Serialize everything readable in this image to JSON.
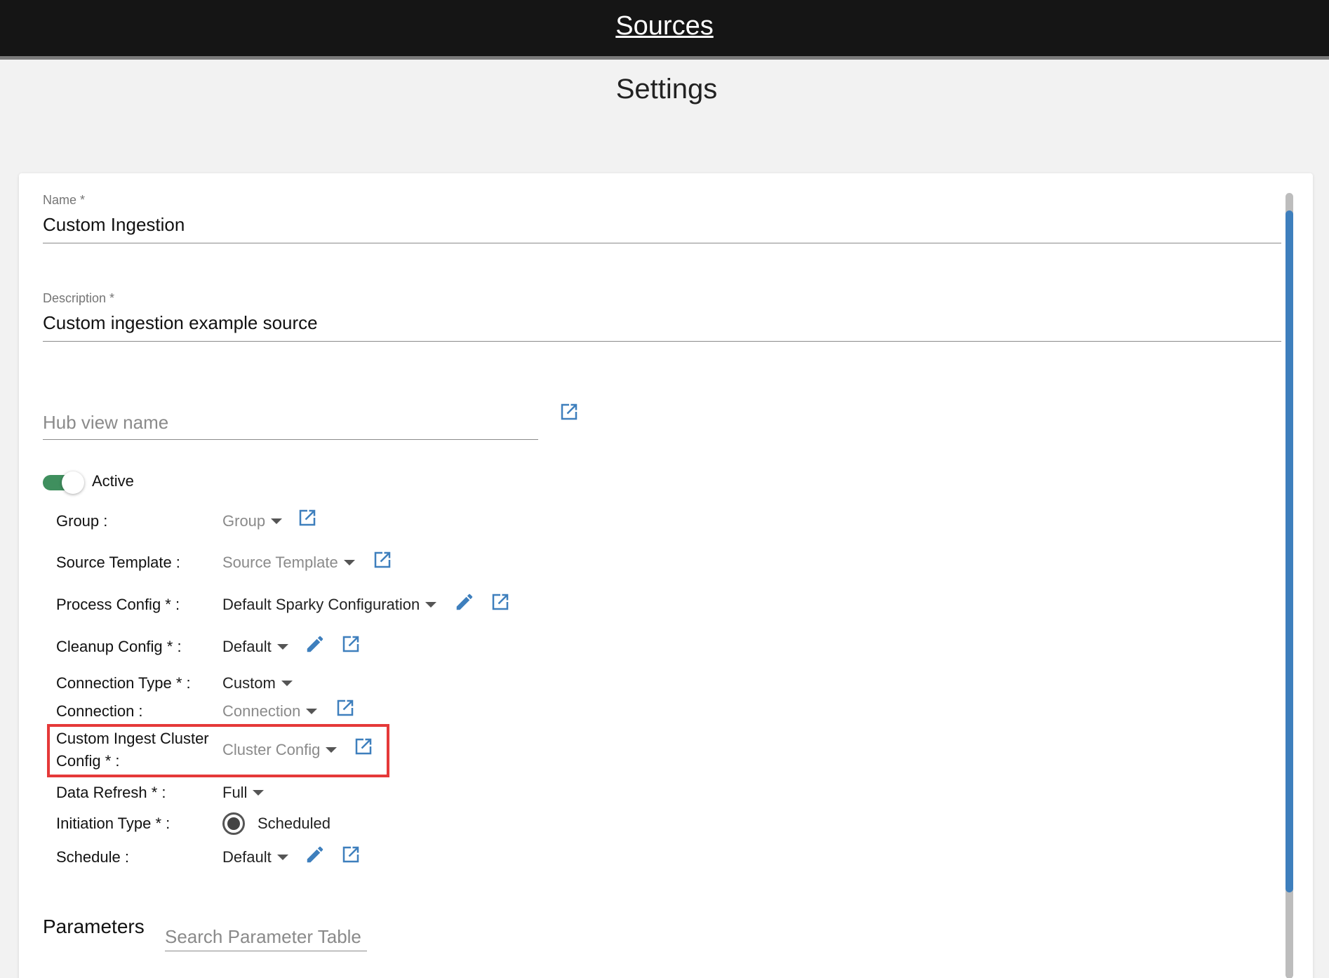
{
  "header": {
    "link_label": "Sources"
  },
  "page": {
    "title": "Settings"
  },
  "form": {
    "name": {
      "label": "Name *",
      "value": "Custom Ingestion"
    },
    "description": {
      "label": "Description *",
      "value": "Custom ingestion example source"
    },
    "hub_view": {
      "placeholder": "Hub view name"
    },
    "active": {
      "label": "Active",
      "checked": true
    },
    "rows": {
      "group": {
        "label": "Group :",
        "value": "Group"
      },
      "source_template": {
        "label": "Source Template :",
        "value": "Source Template"
      },
      "process_config": {
        "label": "Process Config * :",
        "value": "Default Sparky Configuration"
      },
      "cleanup_config": {
        "label": "Cleanup Config * :",
        "value": "Default"
      },
      "connection_type": {
        "label": "Connection Type * :",
        "value": "Custom"
      },
      "connection": {
        "label": "Connection :",
        "value": "Connection"
      },
      "cluster_config": {
        "label_line1": "Custom Ingest Cluster",
        "label_line2": "Config * :",
        "value": "Cluster Config"
      },
      "data_refresh": {
        "label": "Data Refresh * :",
        "value": "Full"
      },
      "initiation_type": {
        "label": "Initiation Type * :",
        "value": "Scheduled"
      },
      "schedule": {
        "label": "Schedule :",
        "value": "Default"
      }
    }
  },
  "parameters": {
    "title": "Parameters",
    "search_placeholder": "Search Parameter Table"
  },
  "icons": {
    "open_external": "open-external-icon",
    "edit": "pencil-icon",
    "dropdown": "caret-down-icon"
  },
  "colors": {
    "accent": "#3e7fbd",
    "toggle_on": "#3f8f5e",
    "highlight": "#e53939",
    "topbar": "#151515"
  }
}
